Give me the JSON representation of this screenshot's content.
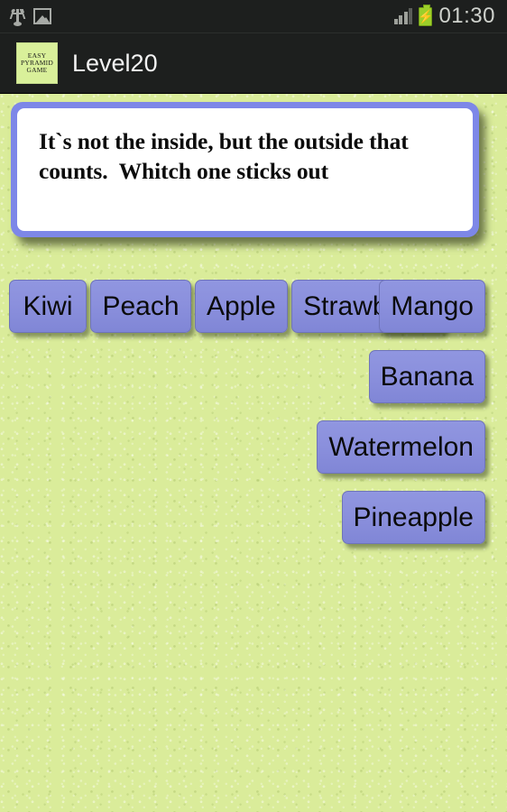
{
  "status_bar": {
    "icons": [
      "usb-icon",
      "picture-icon"
    ],
    "signal_icon": "signal-bars-icon",
    "signal_bars_filled": 3,
    "signal_bars_total": 4,
    "battery_icon": "battery-charging-icon",
    "battery_color": "#9ccf2a",
    "clock": "01:30"
  },
  "action_bar": {
    "app_icon_lines": [
      "EASY",
      "PYRAMID",
      "GAME"
    ],
    "app_icon_color": "#d9f09a",
    "title": "Level20",
    "background": "#1d1f1e"
  },
  "riddle": {
    "text": "It`s not the inside, but the outside that counts.  Whitch one sticks out",
    "border_color": "#7d87e8",
    "panel_color": "#ffffff"
  },
  "answers": {
    "button_color": "#8b90dd",
    "left": [
      {
        "label": "Kiwi"
      },
      {
        "label": "Peach"
      },
      {
        "label": "Apple"
      },
      {
        "label": "Strawberry"
      }
    ],
    "right": [
      {
        "label": "Mango"
      },
      {
        "label": "Banana"
      },
      {
        "label": "Watermelon"
      },
      {
        "label": "Pineapple"
      }
    ]
  },
  "background_color": "#daec9a"
}
